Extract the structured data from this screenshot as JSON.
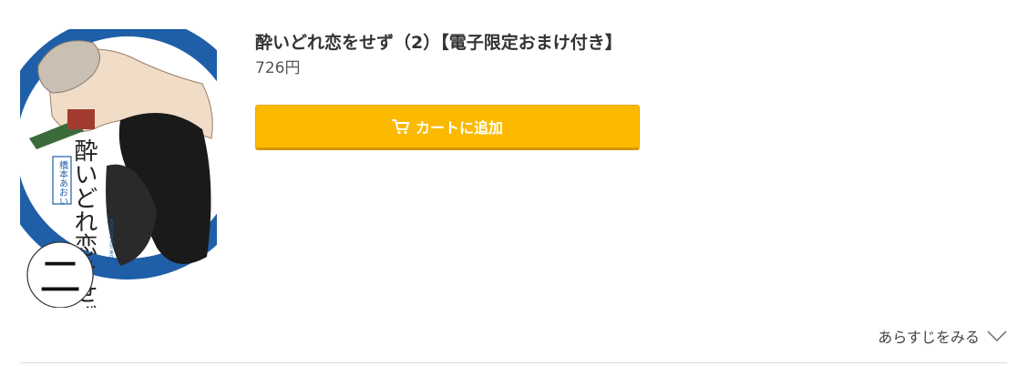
{
  "product": {
    "title": "酔いどれ恋をせず（2）【電子限定おまけ付き】",
    "price": "726円",
    "cover": {
      "title_text": "酔いどれ恋をせず",
      "author_text": "橋本あおい",
      "romaji_text": "yoidore koi wo sezu",
      "volume_text": "二",
      "accent_color": "#1f5fa8"
    }
  },
  "cart": {
    "label": "カートに追加",
    "icon": "cart-icon",
    "color": "#fbb900"
  },
  "synopsis": {
    "label": "あらすじをみる",
    "icon": "chevron-down-icon"
  }
}
